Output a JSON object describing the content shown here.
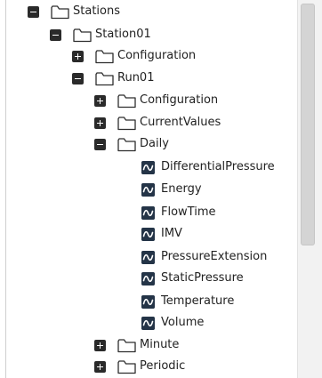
{
  "tree": {
    "stations": "Stations",
    "station01": "Station01",
    "station_configuration": "Configuration",
    "run01": "Run01",
    "run_configuration": "Configuration",
    "current_values": "CurrentValues",
    "daily": "Daily",
    "daily_items": [
      "DifferentialPressure",
      "Energy",
      "FlowTime",
      "IMV",
      "PressureExtension",
      "StaticPressure",
      "Temperature",
      "Volume"
    ],
    "minute": "Minute",
    "periodic": "Periodic"
  },
  "colors": {
    "toggle": "#2a2a2a",
    "signal_icon": "#243447",
    "scrollbar_thumb": "#d4d4d4"
  }
}
